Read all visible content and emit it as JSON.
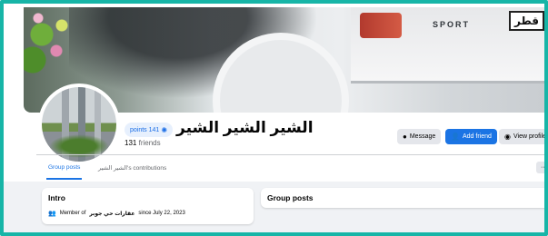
{
  "cover": {
    "badge_text": "SPORT",
    "plate_text": "قطر"
  },
  "profile": {
    "name": "الشير الشير الشير",
    "points": "points 141",
    "friends_count": "131",
    "friends_label": "friends"
  },
  "actions": {
    "message": "Message",
    "add_friend": "Add friend",
    "view_profile": "View profile"
  },
  "tabs": {
    "group_posts": "Group posts",
    "contributions": "الشير الشير's contributions",
    "more": "···"
  },
  "intro": {
    "title": "Intro",
    "member_prefix": "Member of",
    "group_name": "عقارات حي جوبر",
    "since": "since July 22, 2023"
  },
  "group_posts_card": {
    "title": "Group posts"
  },
  "colors": {
    "frame": "#17b5a7",
    "accent": "#1b74e4",
    "button_gray": "#e4e6eb",
    "page_bg": "#f0f2f5"
  },
  "icons": {
    "points": "star-badge-icon",
    "message": "messenger-icon",
    "add_friend": "person-plus-icon",
    "view_profile": "eye-icon",
    "intro_member": "group-icon"
  }
}
